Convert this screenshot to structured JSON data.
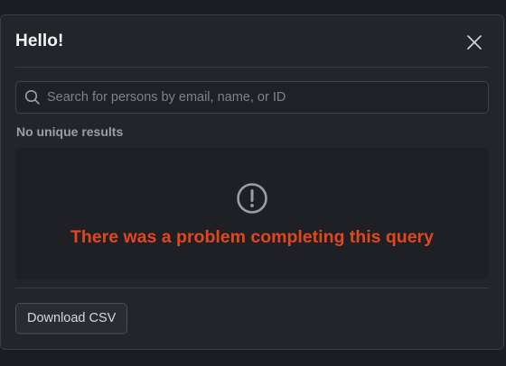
{
  "modal": {
    "title": "Hello!",
    "close_icon": "close-icon"
  },
  "search": {
    "placeholder": "Search for persons by email, name, or ID",
    "value": "",
    "icon": "search-icon"
  },
  "results": {
    "label": "No unique results"
  },
  "error": {
    "icon": "exclamation-circle-icon",
    "message": "There was a problem completing this query",
    "color": "#e2471b"
  },
  "footer": {
    "download_label": "Download CSV"
  }
}
